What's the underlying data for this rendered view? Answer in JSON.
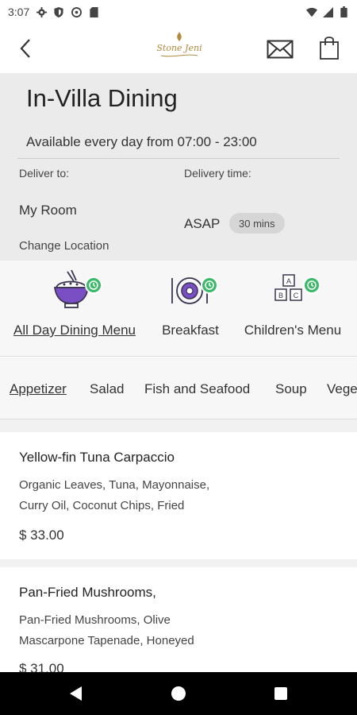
{
  "status_bar": {
    "time": "3:07"
  },
  "header": {
    "logo_text": "Stone Jeni"
  },
  "info": {
    "title": "In-Villa Dining",
    "availability": "Available every day from 07:00 - 23:00",
    "deliver_to_label": "Deliver to:",
    "delivery_time_label": "Delivery time:",
    "location": "My Room",
    "time_value": "ASAP",
    "time_badge": "30 mins",
    "change_location": "Change Location"
  },
  "menus": [
    {
      "label": "All Day Dining Menu",
      "icon": "bowl-icon",
      "active": true
    },
    {
      "label": "Breakfast",
      "icon": "plate-icon",
      "active": false
    },
    {
      "label": "Children's Menu",
      "icon": "blocks-icon",
      "active": false
    }
  ],
  "categories": [
    {
      "label": "Appetizer",
      "active": true
    },
    {
      "label": "Salad"
    },
    {
      "label": "Fish and Seafood"
    },
    {
      "label": "Soup"
    },
    {
      "label": "Vege"
    }
  ],
  "items": [
    {
      "name": "Yellow-fin Tuna Carpaccio",
      "desc_line1": "Organic Leaves, Tuna, Mayonnaise,",
      "desc_line2": "Curry Oil, Coconut Chips, Fried",
      "price": "$ 33.00"
    },
    {
      "name": "Pan-Fried Mushrooms,",
      "desc_line1": "Pan-Fried Mushrooms, Olive",
      "desc_line2": "Mascarpone Tapenade, Honeyed",
      "price": "$ 31.00"
    }
  ],
  "colors": {
    "accent_green": "#3db86a",
    "logo_gold": "#b08a3e"
  }
}
